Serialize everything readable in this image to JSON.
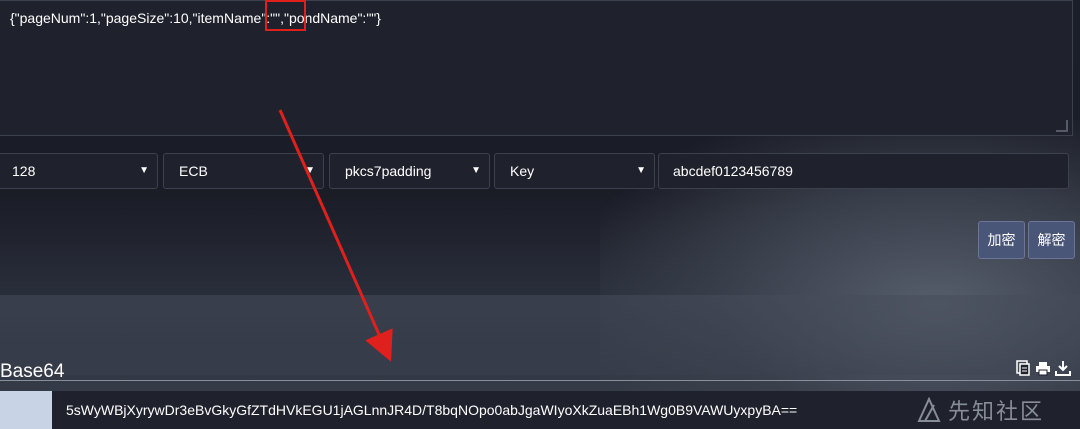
{
  "input": {
    "text": "{\"pageNum\":1,\"pageSize\":10,\"itemName\":\"\",\"pondName\":\"\"}"
  },
  "options": {
    "key_size": "128",
    "mode": "ECB",
    "padding": "pkcs7padding",
    "key_type": "Key",
    "key_value": "abcdef0123456789"
  },
  "buttons": {
    "encrypt": "加密",
    "decrypt": "解密"
  },
  "output": {
    "format_label": "Base64",
    "result": "5sWyWBjXyrywDr3eBvGkyGfZTdHVkEGU1jAGLnnJR4D/T8bqNOpo0abJgaWIyoXkZuaEBh1Wg0B9VAWUyxpyBA=="
  },
  "watermark": {
    "text": "先知社区"
  },
  "colors": {
    "annotation": "#e0201c",
    "button_bg": "#4a5678"
  },
  "icons": [
    "copy-icon",
    "print-icon",
    "download-icon",
    "caret-down-icon"
  ]
}
